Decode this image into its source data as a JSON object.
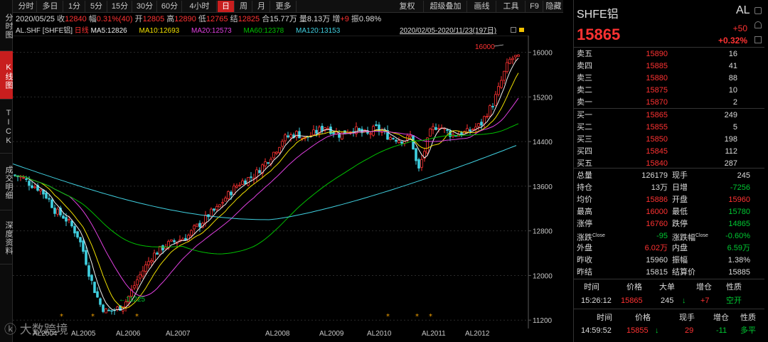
{
  "left_tabs": [
    {
      "label": "分时图",
      "active": false
    },
    {
      "label": "K线图",
      "active": true
    },
    {
      "label": "TICK",
      "active": false
    },
    {
      "label": "成交明细",
      "active": false
    },
    {
      "label": "深度资料",
      "active": false
    }
  ],
  "toolbar": [
    "分时",
    "多日",
    "1分",
    "5分",
    "15分",
    "30分",
    "60分",
    "4小时",
    "日",
    "周",
    "月",
    "更多",
    "复权",
    "超级叠加",
    "画线",
    "工具",
    "F9",
    "隐藏"
  ],
  "info": {
    "date": "2020/05/25",
    "close_label": "收",
    "close": "12840",
    "range_label": "幅",
    "range": "0.31%(40)",
    "open_label": "开",
    "open": "12805",
    "high_label": "高",
    "high": "12890",
    "low_label": "低",
    "low": "12765",
    "settle_label": "结",
    "settle": "12825",
    "oi_label": "合",
    "oi": "15.77万",
    "vol_label": "量",
    "vol": "8.13万",
    "inc_label": "增",
    "inc": "+9",
    "amp_label": "振",
    "amp": "0.98%"
  },
  "ma_bar": {
    "symbol": "AL.SHF [SHFE铝]",
    "type": "日线",
    "ma5": "MA5:12826",
    "ma10": "MA10:12693",
    "ma20": "MA20:12573",
    "ma60": "MA60:12378",
    "ma120": "MA120:13153",
    "range": "2020/02/05-2020/11/23(197日)"
  },
  "colors": {
    "ma5": "#f0f0f0",
    "ma10": "#f0e000",
    "ma20": "#e040e0",
    "ma60": "#00c000",
    "ma120": "#40d0e0",
    "up": "#ff3232",
    "down": "#40d0e0"
  },
  "chart_data": {
    "type": "candlestick",
    "y_ticks": [
      "16000",
      "15200",
      "14400",
      "13600",
      "12800",
      "12000",
      "11200"
    ],
    "x_labels": [
      "AL2004",
      "AL2005",
      "AL2006",
      "AL2007",
      "AL2008",
      "AL2009",
      "AL2010",
      "AL2011",
      "AL2012"
    ],
    "high_marker": "16000",
    "low_marker": "11225"
  },
  "watermark": "大数跨境",
  "quote": {
    "name": "SHFE铝",
    "code": "AL",
    "price": "15865",
    "change": "+50",
    "change_pct": "+0.32%",
    "asks": [
      {
        "label": "卖五",
        "price": "15890",
        "vol": "16"
      },
      {
        "label": "卖四",
        "price": "15885",
        "vol": "41"
      },
      {
        "label": "卖三",
        "price": "15880",
        "vol": "88"
      },
      {
        "label": "卖二",
        "price": "15875",
        "vol": "10"
      },
      {
        "label": "卖一",
        "price": "15870",
        "vol": "2"
      }
    ],
    "bids": [
      {
        "label": "买一",
        "price": "15865",
        "vol": "249"
      },
      {
        "label": "买二",
        "price": "15855",
        "vol": "5"
      },
      {
        "label": "买三",
        "price": "15850",
        "vol": "198"
      },
      {
        "label": "买四",
        "price": "15845",
        "vol": "112"
      },
      {
        "label": "买五",
        "price": "15840",
        "vol": "287"
      }
    ],
    "stats": [
      {
        "l1": "总量",
        "v1": "126179",
        "c1": "wt",
        "l2": "现手",
        "v2": "245",
        "c2": "wt"
      },
      {
        "l1": "持仓",
        "v1": "13万",
        "c1": "wt",
        "l2": "日增",
        "v2": "-7256",
        "c2": "dn"
      },
      {
        "l1": "均价",
        "v1": "15886",
        "c1": "up",
        "l2": "开盘",
        "v2": "15960",
        "c2": "up"
      },
      {
        "l1": "最高",
        "v1": "16000",
        "c1": "up",
        "l2": "最低",
        "v2": "15780",
        "c2": "dn"
      },
      {
        "l1": "涨停",
        "v1": "16760",
        "c1": "up",
        "l2": "跌停",
        "v2": "14865",
        "c2": "dn"
      },
      {
        "l1": "涨跌",
        "s1": "Close",
        "v1": "-95",
        "c1": "dn",
        "l2": "涨跌幅",
        "s2": "Close",
        "v2": "-0.60%",
        "c2": "dn"
      },
      {
        "l1": "外盘",
        "v1": "6.02万",
        "c1": "up",
        "l2": "内盘",
        "v2": "6.59万",
        "c2": "dn"
      },
      {
        "l1": "昨收",
        "v1": "15960",
        "c1": "wt",
        "l2": "振幅",
        "v2": "1.38%",
        "c2": "wt"
      },
      {
        "l1": "昨结",
        "v1": "15815",
        "c1": "wt",
        "l2": "结算价",
        "v2": "15885",
        "c2": "wt"
      }
    ],
    "trades_header": [
      "时间",
      "价格",
      "大单",
      "增仓",
      "性质"
    ],
    "trades": [
      {
        "time": "15:26:12",
        "price": "15865",
        "big": "245",
        "arrow": "↓",
        "inc": "+7",
        "nature": "空开"
      }
    ],
    "ticks_header": [
      "时间",
      "价格",
      "现手",
      "增仓",
      "性质"
    ],
    "ticks": [
      {
        "time": "14:59:52",
        "price": "15855",
        "arrow": "↓",
        "vol": "29",
        "inc": "-11",
        "nature": "多平"
      }
    ]
  }
}
